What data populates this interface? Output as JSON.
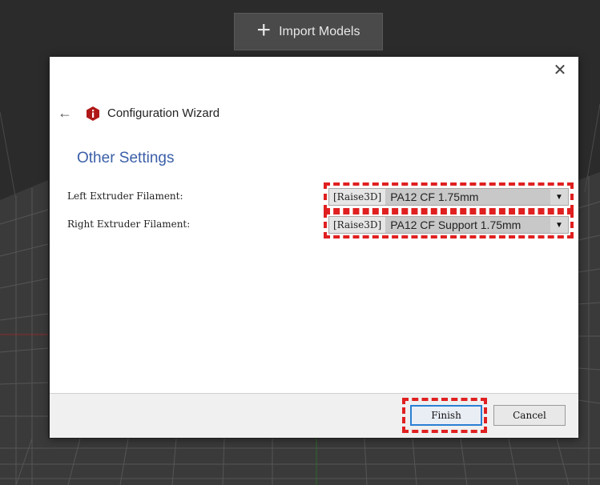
{
  "toolbar": {
    "import_label": "Import Models",
    "import_icon": "plus-icon"
  },
  "dialog": {
    "close_glyph": "✕",
    "back_glyph": "←",
    "title": "Configuration Wizard",
    "section_title": "Other Settings",
    "rows": [
      {
        "label": "Left Extruder Filament:",
        "brand": "[Raise3D]",
        "material": "PA12 CF 1.75mm"
      },
      {
        "label": "Right Extruder Filament:",
        "brand": "[Raise3D]",
        "material": "PA12 CF Support 1.75mm"
      }
    ],
    "dropdown_glyph": "▼",
    "finish_label": "Finish",
    "cancel_label": "Cancel"
  },
  "colors": {
    "highlight": "#e02020",
    "section_title": "#3b5fa8",
    "logo": "#b01818",
    "primary_border": "#2a7fd4"
  }
}
